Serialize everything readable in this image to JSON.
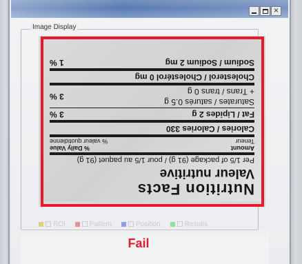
{
  "window": {
    "buttons": {
      "minimize": "_",
      "maximize": "□",
      "close": "×"
    }
  },
  "image_display": {
    "group_label": "Image Display",
    "label": {
      "title": "Nutrition Facts",
      "subtitle": "Valeur nutritive",
      "serving": "Per 1/5 of package (91 g) / pour 1/5 au paquet (91 g)",
      "header_left_1": "Amount",
      "header_left_2": "Teneur",
      "header_right_1": "% Daily Value",
      "header_right_2": "% valeur quotidienne",
      "rows": [
        {
          "left": "Calories / Calories 330",
          "right": ""
        },
        {
          "left": "Fat / Lipides 2 g",
          "right": "3 %"
        },
        {
          "left": "Saturates / saturés 0.5 g",
          "right": "3 %"
        },
        {
          "left": "+ Trans / trans 0 g",
          "right": ""
        },
        {
          "left": "Cholesterol / Cholestérol 0 mg",
          "right": ""
        },
        {
          "left": "Sodium / Sodium 2 mg",
          "right": "1 %"
        }
      ]
    }
  },
  "legend": {
    "items": [
      {
        "label": "ROI",
        "color": "#d9c64a"
      },
      {
        "label": "Pattern",
        "color": "#e46a6a"
      },
      {
        "label": "Position",
        "color": "#6a7fd9"
      },
      {
        "label": "Results",
        "color": "#6ad96a"
      }
    ]
  },
  "status": {
    "text": "Fail",
    "color": "#e51a2a"
  }
}
